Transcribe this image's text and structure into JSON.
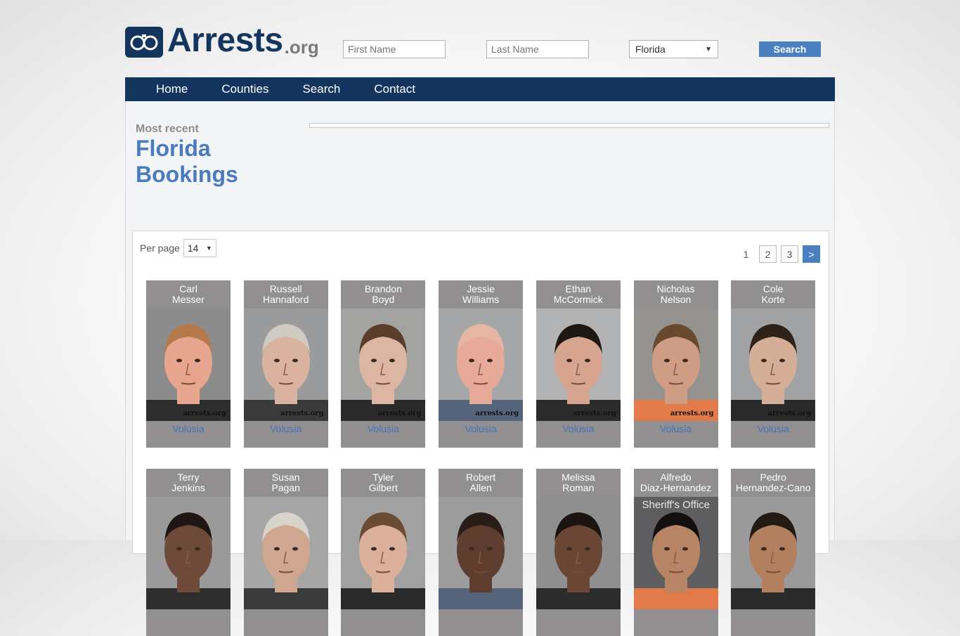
{
  "logo": {
    "name": "Arrests",
    "tld": ".org"
  },
  "search": {
    "first_placeholder": "First Name",
    "last_placeholder": "Last Name",
    "state_selected": "Florida",
    "button_label": "Search"
  },
  "nav": {
    "items": [
      "Home",
      "Counties",
      "Search",
      "Contact"
    ]
  },
  "page": {
    "kicker": "Most recent",
    "title_line1": "Florida",
    "title_line2": "Bookings"
  },
  "list": {
    "per_page_label": "Per page",
    "per_page_value": "14",
    "pagination": {
      "current": "1",
      "pages": [
        "2",
        "3"
      ],
      "next": ">"
    }
  },
  "watermark": "arrests.org",
  "sheriff_overlay": "Sheriff's Office",
  "cards": [
    {
      "first": "Carl",
      "last": "Messer",
      "county": "Volusia"
    },
    {
      "first": "Russell",
      "last": "Hannaford",
      "county": "Volusia"
    },
    {
      "first": "Brandon",
      "last": "Boyd",
      "county": "Volusia"
    },
    {
      "first": "Jessie",
      "last": "Williams",
      "county": "Volusia"
    },
    {
      "first": "Ethan",
      "last": "McCormick",
      "county": "Volusia"
    },
    {
      "first": "Nicholas",
      "last": "Nelson",
      "county": "Volusia"
    },
    {
      "first": "Cole",
      "last": "Korte",
      "county": "Volusia"
    },
    {
      "first": "Terry",
      "last": "Jenkins"
    },
    {
      "first": "Susan",
      "last": "Pagan"
    },
    {
      "first": "Tyler",
      "last": "Gilbert"
    },
    {
      "first": "Robert",
      "last": "Allen"
    },
    {
      "first": "Melissa",
      "last": "Roman"
    },
    {
      "first": "Alfredo",
      "last": "Diaz-Hernandez"
    },
    {
      "first": "Pedro",
      "last": "Hernandez-Cano"
    }
  ],
  "colors": {
    "navy": "#14365e",
    "accent_blue": "#4a7fc0",
    "link_blue": "#3f74c0"
  }
}
